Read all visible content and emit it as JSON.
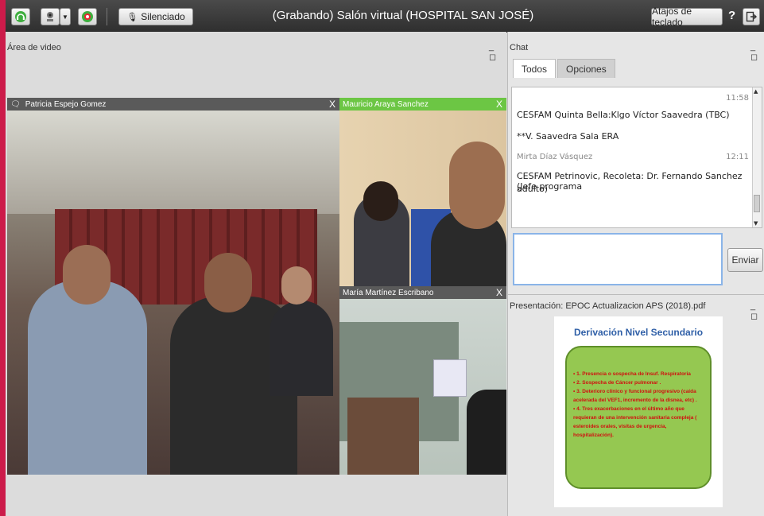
{
  "topbar": {
    "mute_label": "Silenciado",
    "title": "(Grabando) Salón virtual (HOSPITAL SAN JOSÉ)",
    "shortcuts_label": "Atajos de teclado",
    "help_label": "?"
  },
  "video_area": {
    "title": "Área de video",
    "feeds": [
      {
        "name": "Patricia Espejo Gomez",
        "close": "X"
      },
      {
        "name": "Mauricio Araya Sanchez",
        "close": "X"
      },
      {
        "name": "María Martínez Escribano",
        "close": "X"
      }
    ]
  },
  "chat": {
    "title": "Chat",
    "tabs": [
      "Todos",
      "Opciones"
    ],
    "messages": [
      {
        "time": "11:58",
        "lines": [
          "CESFAM Quinta Bella:Klgo Víctor Saavedra (TBC)",
          "**V. Saavedra Sala ERA"
        ]
      },
      {
        "author": "Mirta Díaz Vásquez",
        "time": "12:11",
        "lines": [
          "CESFAM Petrinovic, Recoleta: Dr. Fernando Sanchez (Jefe programa",
          "adulto)"
        ]
      }
    ],
    "send_label": "Enviar"
  },
  "presentation": {
    "title": "Presentación: EPOC Actualizacion APS (2018).pdf",
    "slide_title": "Derivación Nivel Secundario",
    "slide_items": [
      "• 1. Presencia o sospecha de Insuf. Respiratoria",
      "• 2. Sospecha de Cáncer pulmonar .",
      "• 3. Deterioro clínico y funcional progresivo (caída acelerada del VEF1, incremento de la disnea, etc) .",
      "• 4. Tres exacerbaciones en el último año que requieran de una intervención sanitaria compleja ( esteroides orales, visitas de urgencia, hospitalización)."
    ]
  },
  "colors": {
    "accent_red": "#cc1b4a",
    "speaker_green": "#6cc644",
    "feed_gray": "#5a5a5a"
  }
}
